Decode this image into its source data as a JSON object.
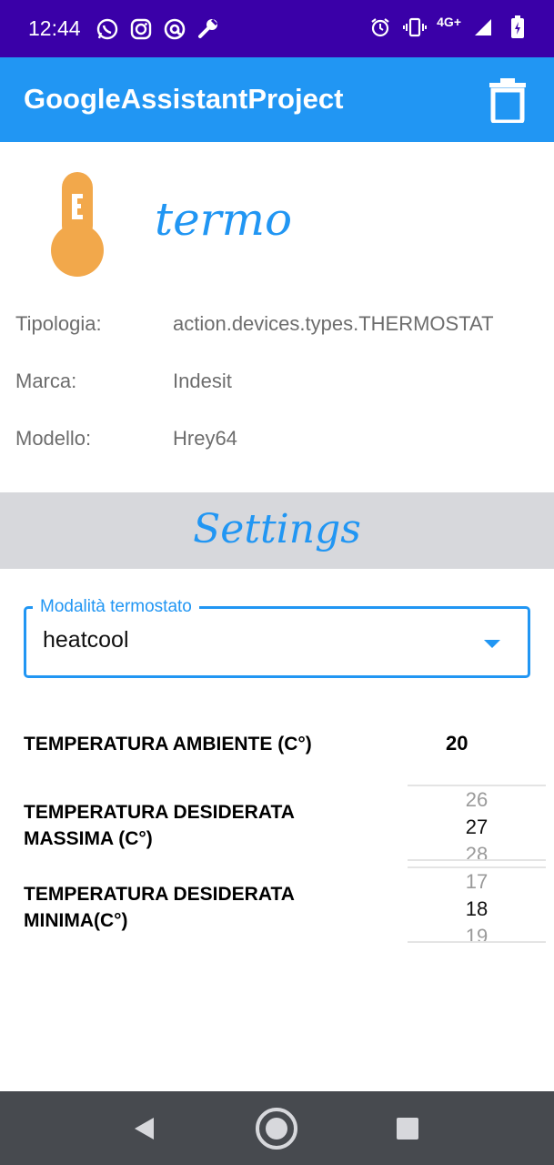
{
  "status_bar": {
    "time": "12:44",
    "network": "4G+",
    "left_icons": [
      "whatsapp-icon",
      "instagram-icon",
      "at-sign-icon",
      "wrench-icon"
    ],
    "right_icons": [
      "alarm-icon",
      "vibrate-icon",
      "signal-icon",
      "battery-icon"
    ]
  },
  "app_bar": {
    "title": "GoogleAssistantProject",
    "delete_icon": "trash-icon",
    "color": "#2196f3"
  },
  "device": {
    "icon": "thermometer-icon",
    "icon_color": "#f2a84b",
    "name": "termo",
    "info": [
      {
        "label": "Tipologia:",
        "value": "action.devices.types.THERMOSTAT"
      },
      {
        "label": "Marca:",
        "value": "Indesit"
      },
      {
        "label": "Modello:",
        "value": "Hrey64"
      }
    ]
  },
  "settings": {
    "title": "Settings",
    "mode": {
      "label": "Modalità termostato",
      "value": "heatcool"
    },
    "ambient": {
      "label": "TEMPERATURA AMBIENTE (C°)",
      "value": "20"
    },
    "max": {
      "label_line1": "TEMPERATURA DESIDERATA",
      "label_line2": "MASSIMA (C°)",
      "picker": {
        "prev": "26",
        "selected": "27",
        "next": "28"
      }
    },
    "min": {
      "label_line1": "TEMPERATURA DESIDERATA",
      "label_line2": "MINIMA(C°)",
      "picker": {
        "prev": "17",
        "selected": "18",
        "next": "19"
      }
    }
  },
  "nav_bar": {
    "buttons": [
      "back-icon",
      "home-icon",
      "recents-icon"
    ]
  }
}
